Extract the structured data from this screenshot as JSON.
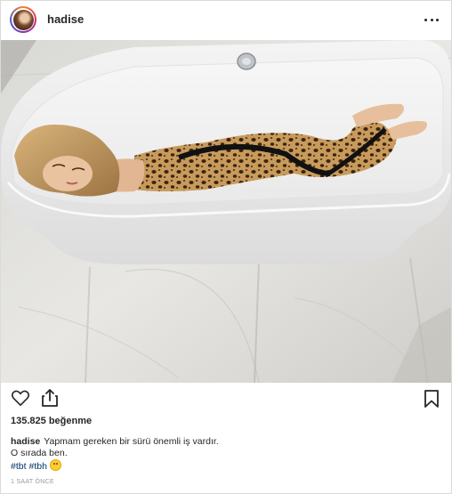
{
  "header": {
    "username": "hadise",
    "more_icon": "ellipsis-icon"
  },
  "photo": {
    "alt": "woman in leopard print outfit lying in white bathtub on marble floor"
  },
  "actions": {
    "like_icon": "heart-icon",
    "share_icon": "share-icon",
    "save_icon": "bookmark-icon"
  },
  "likes": {
    "text": "135.825 beğenme"
  },
  "caption": {
    "username": "hadise",
    "line1": "Yapmam gereken bir sürü önemli iş vardır.",
    "line2": "O sırada ben.",
    "hashtags": [
      "#tbt",
      "#tbh"
    ],
    "emoji": "grinning-sweat-emoji"
  },
  "timestamp": "1 SAAT ÖNCE",
  "colors": {
    "hashtag": "#003569",
    "text": "#262626",
    "muted": "#999999",
    "border": "#dbdbdb"
  }
}
